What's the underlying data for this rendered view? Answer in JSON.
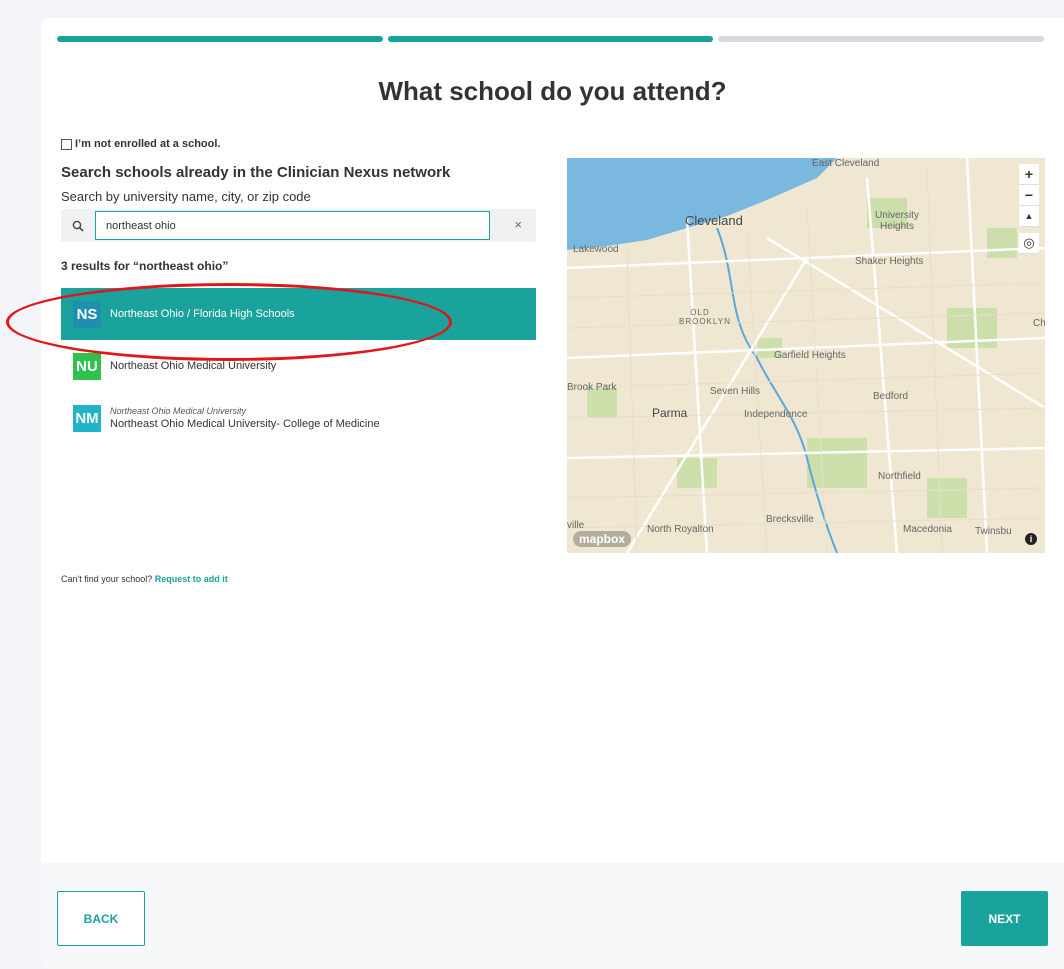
{
  "progress": {
    "segments": [
      {
        "color": "#1aa29c"
      },
      {
        "color": "#1aa29c"
      },
      {
        "color": "#d6d9e0"
      }
    ]
  },
  "title": "What school do you attend?",
  "not_enrolled_label": "I’m not enrolled at a school.",
  "search": {
    "heading": "Search schools already in the Clinician Nexus network",
    "hint": "Search by university name, city, or zip code",
    "value": "northeast ohio",
    "clear_glyph": "×"
  },
  "results_count_text": "3 results for “northeast ohio”",
  "results": [
    {
      "initials": "NS",
      "badge_color": "#1f8fb0",
      "name": "Northeast Ohio / Florida High Schools",
      "parent": "",
      "selected": true
    },
    {
      "initials": "NU",
      "badge_color": "#2ec24d",
      "name": "Northeast Ohio Medical University",
      "parent": "",
      "selected": false
    },
    {
      "initials": "NM",
      "badge_color": "#20b4c8",
      "name": "Northeast Ohio Medical University- College of Medicine",
      "parent": "Northeast Ohio Medical University",
      "selected": false
    }
  ],
  "cant_find": {
    "text": "Can't find your school?",
    "link": "Request to add it"
  },
  "map": {
    "labels": [
      "East Cleveland",
      "Cleveland",
      "University Heights",
      "Lakewood",
      "Shaker Heights",
      "OLD BROOKLYN",
      "Garfield Heights",
      "Brook Park",
      "Seven Hills",
      "Bedford",
      "Parma",
      "Independence",
      "Northfield",
      "Brecksville",
      "North Royalton",
      "Macedonia",
      "Twinsbu",
      "Ch",
      "ville"
    ],
    "controls": {
      "zoom_in": "+",
      "zoom_out": "−",
      "compass": "▲",
      "locate": "◎"
    },
    "logo": "mapbox",
    "info": "i"
  },
  "footer": {
    "back_label": "BACK",
    "next_label": "NEXT"
  },
  "colors": {
    "accent": "#1aa29c",
    "annotation": "#e0161b",
    "water": "#7ab8e0"
  }
}
